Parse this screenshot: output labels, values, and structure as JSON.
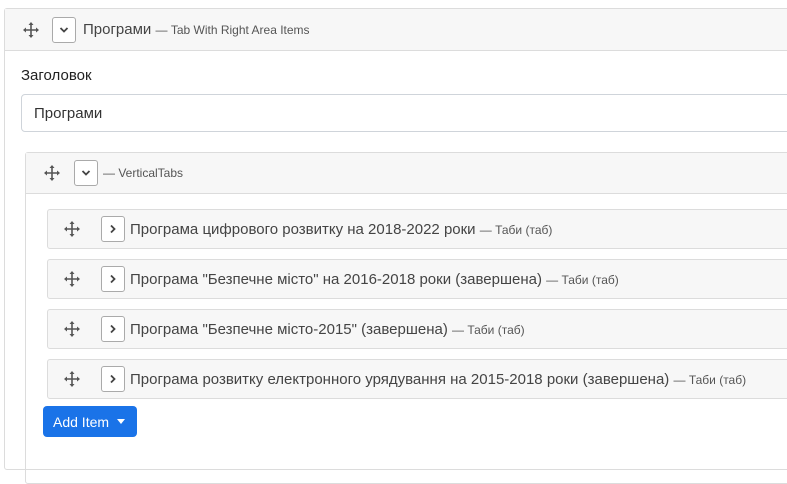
{
  "outer": {
    "title": "Програми",
    "subtitle": "— Tab With Right Area Items"
  },
  "field": {
    "label": "Заголовок",
    "value": "Програми"
  },
  "inner": {
    "subtitle": "— VerticalTabs"
  },
  "items": [
    {
      "title": "Програма цифрового розвитку на 2018-2022 роки",
      "subtitle": "— Таби (таб)"
    },
    {
      "title": "Програма \"Безпечне місто\" на 2016-2018 роки (завершена)",
      "subtitle": "— Таби (таб)"
    },
    {
      "title": "Програма \"Безпечне місто-2015\" (завершена)",
      "subtitle": "— Таби (таб)"
    },
    {
      "title": "Програма розвитку електронного урядування на 2015-2018 роки (завершена)",
      "subtitle": "— Таби (таб)"
    }
  ],
  "add_button": {
    "label": "Add Item"
  },
  "colors": {
    "accent": "#1a73e8",
    "panel_bg": "#f7f7f7",
    "border": "#dcdcdc"
  }
}
